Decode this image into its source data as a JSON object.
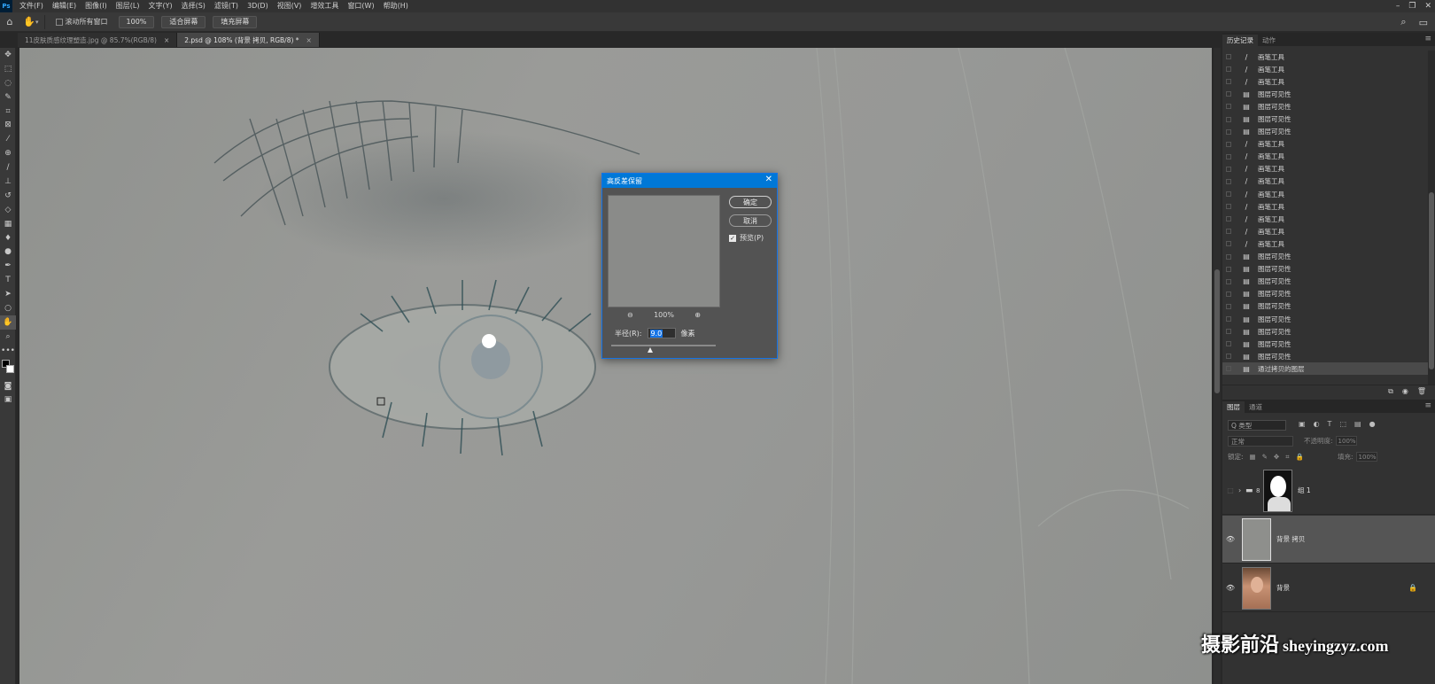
{
  "app": {
    "logo": "Ps"
  },
  "menu": [
    "文件(F)",
    "编辑(E)",
    "图像(I)",
    "图层(L)",
    "文字(Y)",
    "选择(S)",
    "滤镜(T)",
    "3D(D)",
    "视图(V)",
    "增效工具",
    "窗口(W)",
    "帮助(H)"
  ],
  "window_controls": {
    "minimize": "–",
    "restore": "❐",
    "close": "✕"
  },
  "options": {
    "scroll_all_label": "滚动所有窗口",
    "zoom_btn": "100%",
    "fit_btn": "适合屏幕",
    "fill_btn": "填充屏幕"
  },
  "tabs": [
    {
      "label": "11皮肤质感纹理塑造.jpg @ 85.7%(RGB/8)",
      "close": "×"
    },
    {
      "label": "2.psd @ 108% (背景 拷贝, RGB/8) *",
      "close": "×"
    }
  ],
  "dialog": {
    "title": "高反差保留",
    "close": "✕",
    "ok": "确定",
    "cancel": "取消",
    "preview_label": "预览(P)",
    "zoom_out": "⊖",
    "zoom_level": "100%",
    "zoom_in": "⊕",
    "radius_label": "半径(R):",
    "radius_value": "9.0",
    "radius_unit": "像素",
    "slider_position": 0.37
  },
  "history_panel": {
    "tabs": [
      "历史记录",
      "动作"
    ],
    "items": [
      {
        "icon": "brush",
        "label": "画笔工具"
      },
      {
        "icon": "brush",
        "label": "画笔工具"
      },
      {
        "icon": "brush",
        "label": "画笔工具"
      },
      {
        "icon": "doc",
        "label": "图层可见性"
      },
      {
        "icon": "doc",
        "label": "图层可见性"
      },
      {
        "icon": "doc",
        "label": "图层可见性"
      },
      {
        "icon": "doc",
        "label": "图层可见性"
      },
      {
        "icon": "brush",
        "label": "画笔工具"
      },
      {
        "icon": "brush",
        "label": "画笔工具"
      },
      {
        "icon": "brush",
        "label": "画笔工具"
      },
      {
        "icon": "brush",
        "label": "画笔工具"
      },
      {
        "icon": "brush",
        "label": "画笔工具"
      },
      {
        "icon": "brush",
        "label": "画笔工具"
      },
      {
        "icon": "brush",
        "label": "画笔工具"
      },
      {
        "icon": "brush",
        "label": "画笔工具"
      },
      {
        "icon": "brush",
        "label": "画笔工具"
      },
      {
        "icon": "doc",
        "label": "图层可见性"
      },
      {
        "icon": "doc",
        "label": "图层可见性"
      },
      {
        "icon": "doc",
        "label": "图层可见性"
      },
      {
        "icon": "doc",
        "label": "图层可见性"
      },
      {
        "icon": "doc",
        "label": "图层可见性"
      },
      {
        "icon": "doc",
        "label": "图层可见性"
      },
      {
        "icon": "doc",
        "label": "图层可见性"
      },
      {
        "icon": "doc",
        "label": "图层可见性"
      },
      {
        "icon": "doc",
        "label": "图层可见性"
      },
      {
        "icon": "doc",
        "label": "通过拷贝的图层",
        "active": true
      }
    ]
  },
  "layers_panel": {
    "tabs": [
      "图层",
      "通道"
    ],
    "filter_placeholder": "Q 类型",
    "blend_mode": "正常",
    "opacity_label": "不透明度:",
    "opacity_value": "100%",
    "lock_label": "锁定:",
    "fill_label": "填充:",
    "fill_value": "100%",
    "layers": [
      {
        "name": "组 1",
        "visible": false,
        "type": "group"
      },
      {
        "name": "背景 拷贝",
        "visible": true,
        "type": "gray",
        "selected": true
      },
      {
        "name": "背景",
        "visible": true,
        "type": "photo",
        "locked": true
      }
    ]
  },
  "watermark": {
    "cn": "摄影前沿",
    "en": "sheyingzyz.com"
  },
  "colors": {
    "accent": "#0078d7",
    "panel": "#323232",
    "canvas": "#959694"
  }
}
